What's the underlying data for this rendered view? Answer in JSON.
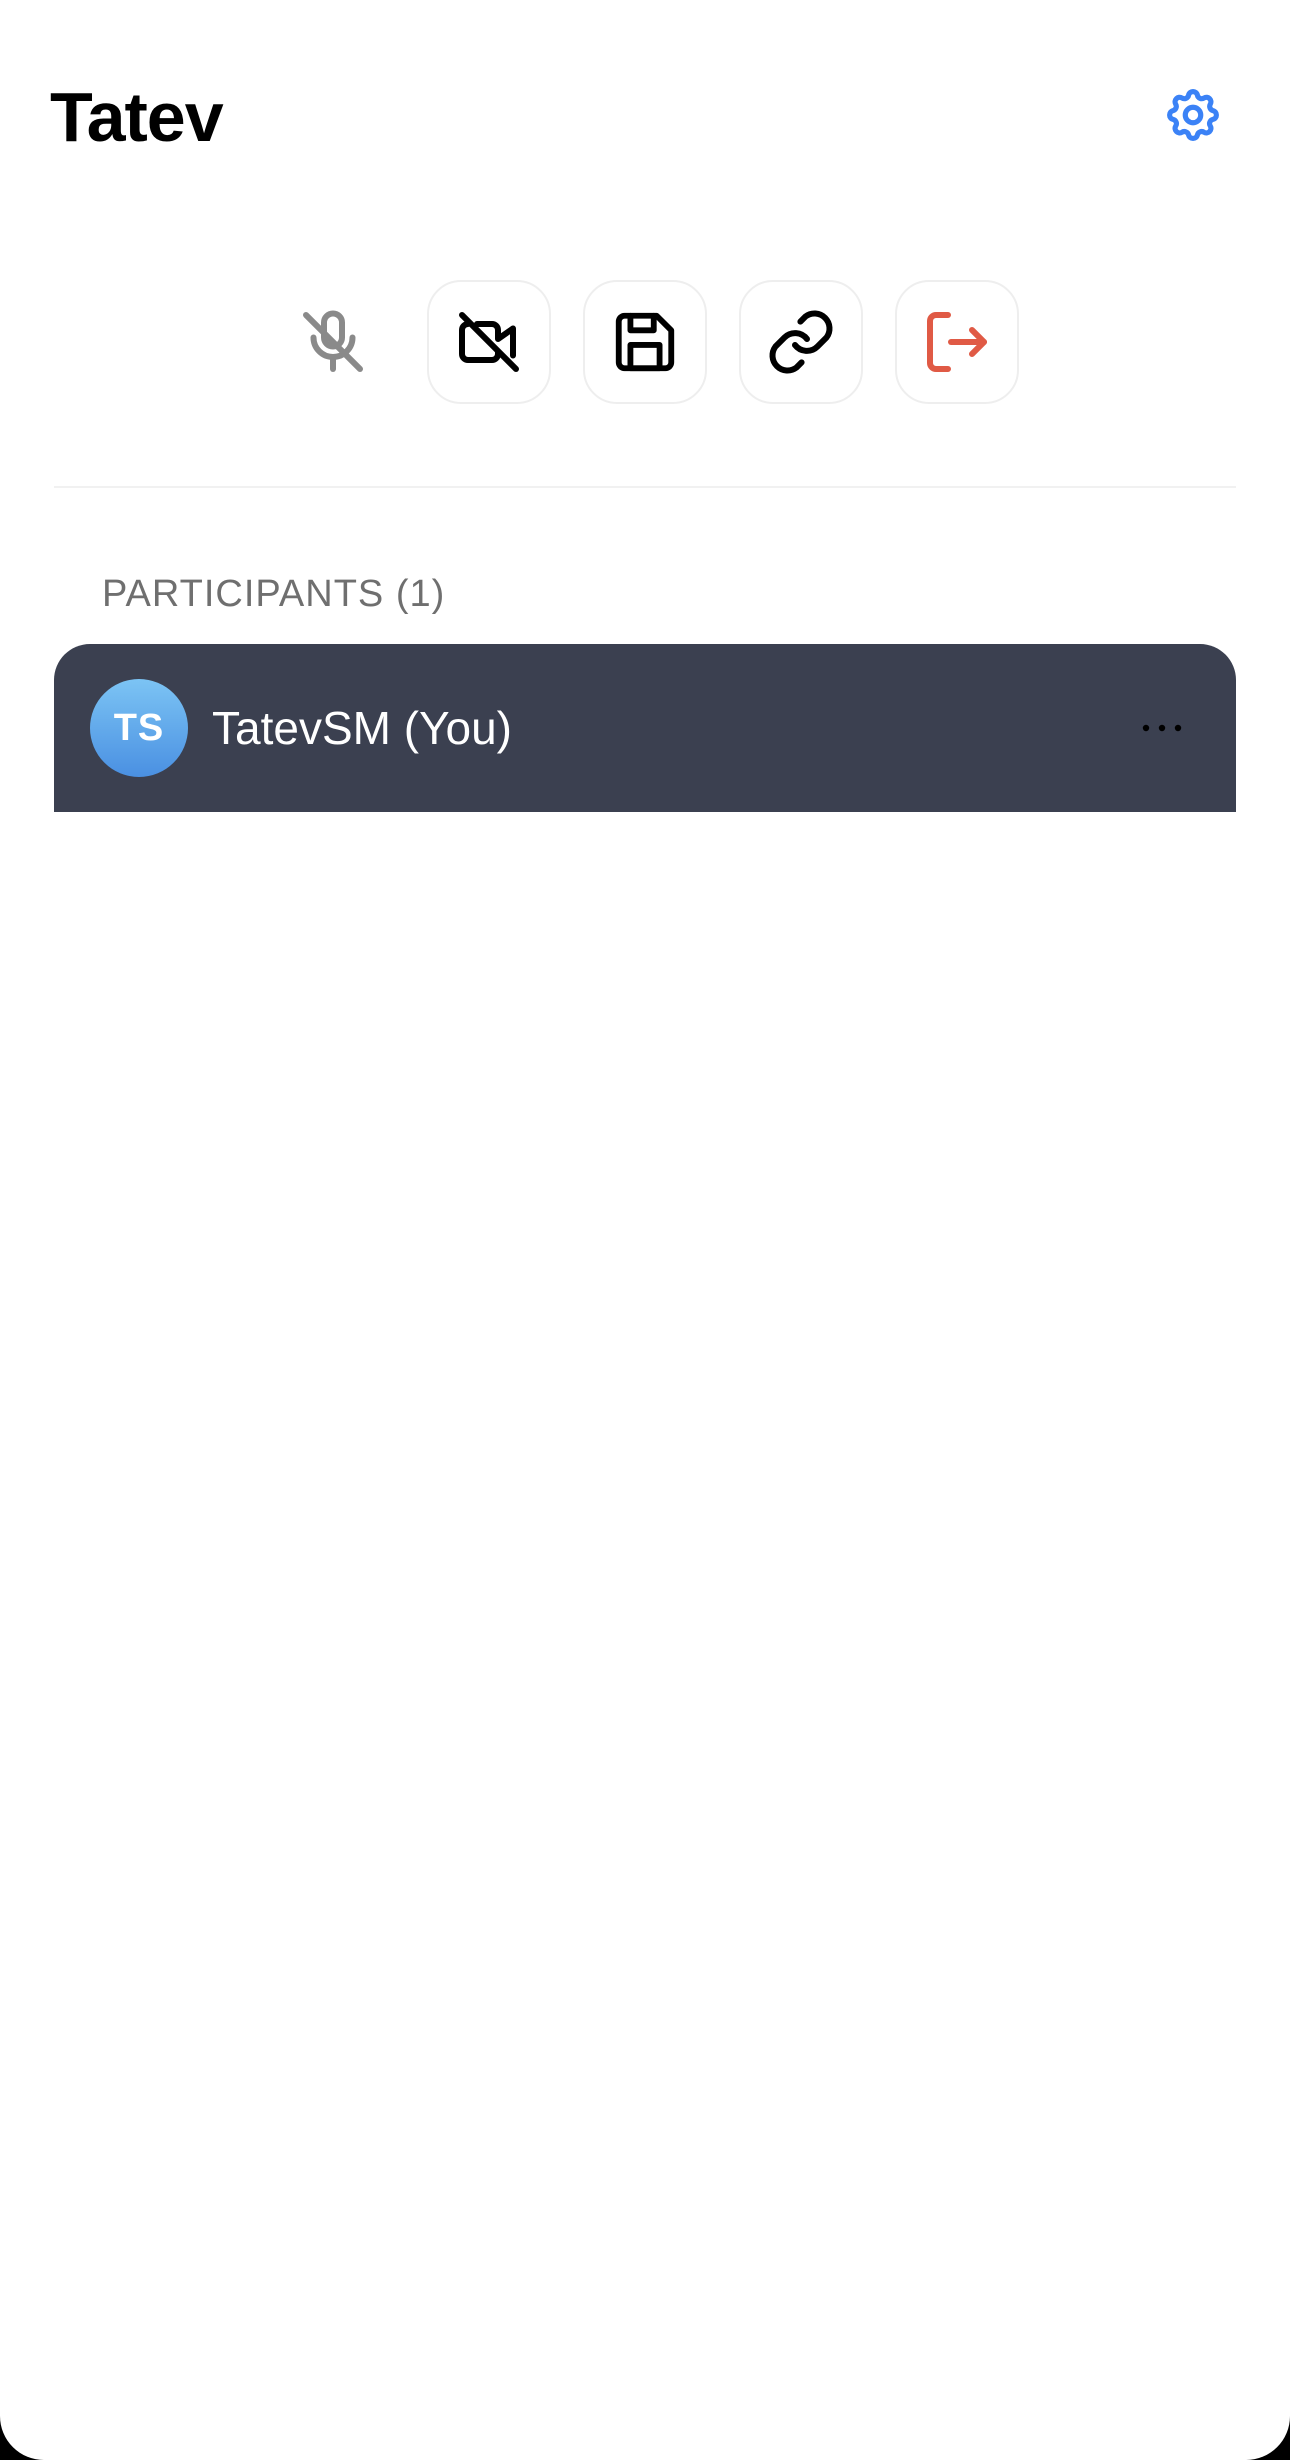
{
  "header": {
    "title": "Tatev",
    "settings_icon": "gear-icon"
  },
  "controls": [
    {
      "name": "microphone-muted",
      "icon": "microphone-off-icon",
      "state": "disabled"
    },
    {
      "name": "camera-off",
      "icon": "video-off-icon"
    },
    {
      "name": "save",
      "icon": "floppy-disk-icon"
    },
    {
      "name": "copy-link",
      "icon": "link-icon"
    },
    {
      "name": "leave",
      "icon": "exit-icon"
    }
  ],
  "participants": {
    "section_label": "PARTICIPANTS (1)",
    "items": [
      {
        "initials": "TS",
        "name": "TatevSM (You)",
        "more_icon": "more-horizontal-icon"
      }
    ]
  },
  "colors": {
    "accent": "#3b82f6",
    "leave": "#e05a45",
    "participant_bg": "#3b4050",
    "muted_icon": "#8a8a8a"
  }
}
